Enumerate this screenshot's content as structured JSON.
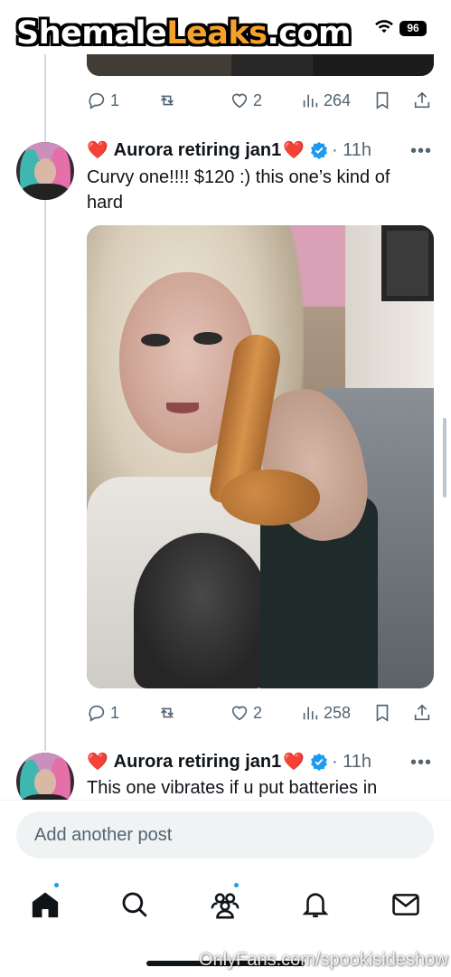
{
  "status_bar": {
    "battery": "96",
    "wifi_icon": "wifi-icon"
  },
  "watermark": {
    "part1": "Shemale",
    "part2": "Leaks",
    "part3": ".com"
  },
  "tweets": [
    {
      "actions": {
        "replies": "1",
        "reposts": "",
        "likes": "2",
        "views": "264"
      }
    },
    {
      "heart_left": "❤️",
      "name": "Aurora retiring jan1",
      "heart_right": "❤️",
      "time": "· 11h",
      "text": "Curvy one!!!! $120 :) this one’s kind of hard",
      "actions": {
        "replies": "1",
        "reposts": "",
        "likes": "2",
        "views": "258"
      }
    },
    {
      "heart_left": "❤️",
      "name": "Aurora retiring jan1",
      "heart_right": "❤️",
      "time": "· 11h",
      "text": "This one vibrates if u put batteries in"
    }
  ],
  "more_label": "•••",
  "reply": {
    "placeholder": "Add another post"
  },
  "tabs": [
    {
      "name": "home",
      "icon": "home-icon",
      "dot": true
    },
    {
      "name": "search",
      "icon": "search-icon",
      "dot": false
    },
    {
      "name": "communities",
      "icon": "communities-icon",
      "dot": true
    },
    {
      "name": "notifications",
      "icon": "bell-icon",
      "dot": false
    },
    {
      "name": "messages",
      "icon": "mail-icon",
      "dot": false
    }
  ],
  "footer_watermark": "OnlyFans.com/spookisideshow",
  "colors": {
    "accent": "#1d9bf0",
    "text": "#0f1419",
    "muted": "#536471",
    "watermark_orange": "#f5a22d"
  }
}
